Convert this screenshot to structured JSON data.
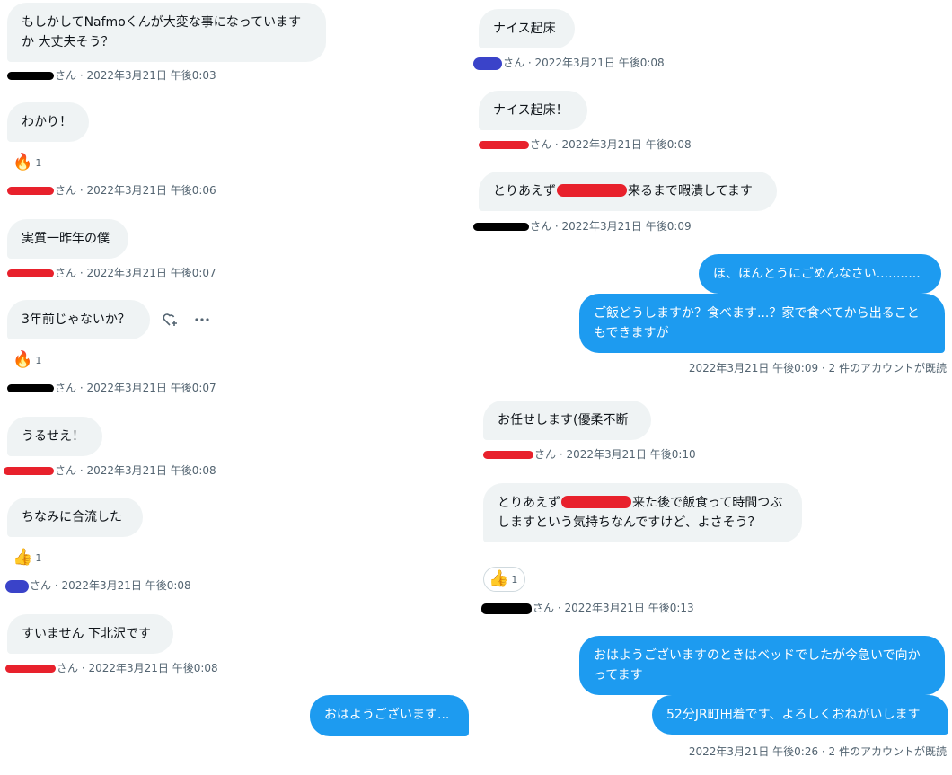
{
  "left": {
    "messages": [
      {
        "text": "もしかしてNafmoくんが大変な事になっていますか 大丈夫そう？",
        "meta": "さん · 2022年3月21日 午後0:03"
      },
      {
        "text": "わかり！",
        "reaction": {
          "emoji": "🔥",
          "count": "1"
        },
        "meta": "さん · 2022年3月21日 午後0:06"
      },
      {
        "text": "実質一昨年の僕",
        "meta": "さん · 2022年3月21日 午後0:07"
      },
      {
        "text": "3年前じゃないか？",
        "reaction": {
          "emoji": "🔥",
          "count": "1"
        },
        "meta": "さん · 2022年3月21日 午後0:07",
        "hover_icons": [
          "add-reaction-icon",
          "more-icon"
        ]
      },
      {
        "text": "うるせえ！",
        "meta": "さん · 2022年3月21日 午後0:08"
      },
      {
        "text": "ちなみに合流した",
        "reaction": {
          "emoji": "👍",
          "count": "1"
        },
        "meta": "さん · 2022年3月21日 午後0:08"
      },
      {
        "text": "すいません 下北沢です",
        "meta": "さん · 2022年3月21日 午後0:08"
      }
    ],
    "outgoing": {
      "text": "おはようございます..."
    }
  },
  "right": {
    "messages": [
      {
        "text": "ナイス起床",
        "meta": "さん · 2022年3月21日 午後0:08"
      },
      {
        "text": "ナイス起床！",
        "meta": "さん · 2022年3月21日 午後0:08"
      },
      {
        "text_before": "とりあえず",
        "text_after": "来るまで暇潰してます",
        "meta": "さん · 2022年3月21日 午後0:09"
      },
      {
        "text": "お任せします(優柔不断",
        "meta": "さん · 2022年3月21日 午後0:10"
      },
      {
        "text_before": "とりあえず",
        "text_after": "来た後で飯食って時間つぶしますという気持ちなんですけど、よさそう？",
        "reaction": {
          "emoji": "👍",
          "count": "1"
        },
        "meta": "さん · 2022年3月21日 午後0:13"
      }
    ],
    "outgoing_group_1": {
      "messages": [
        "ほ、ほんとうにごめんなさい...........",
        "ご飯どうしますか？食べます...？家で食べてから出ることもできますが"
      ],
      "meta": "2022年3月21日 午後0:09 · 2 件のアカウントが既読"
    },
    "outgoing_group_2": {
      "messages": [
        "おはようございますのときはベッドでしたが今急いで向かってます",
        "52分JR町田着です、よろしくおねがいします"
      ],
      "meta": "2022年3月21日 午後0:26 · 2 件のアカウントが既読"
    }
  },
  "colors": {
    "incoming_bg": "#eff3f4",
    "outgoing_bg": "#1d9bf0",
    "meta_text": "#536471",
    "redaction_black": "#000000",
    "redaction_red": "#e8212c",
    "redaction_blue": "#3a43c9"
  }
}
